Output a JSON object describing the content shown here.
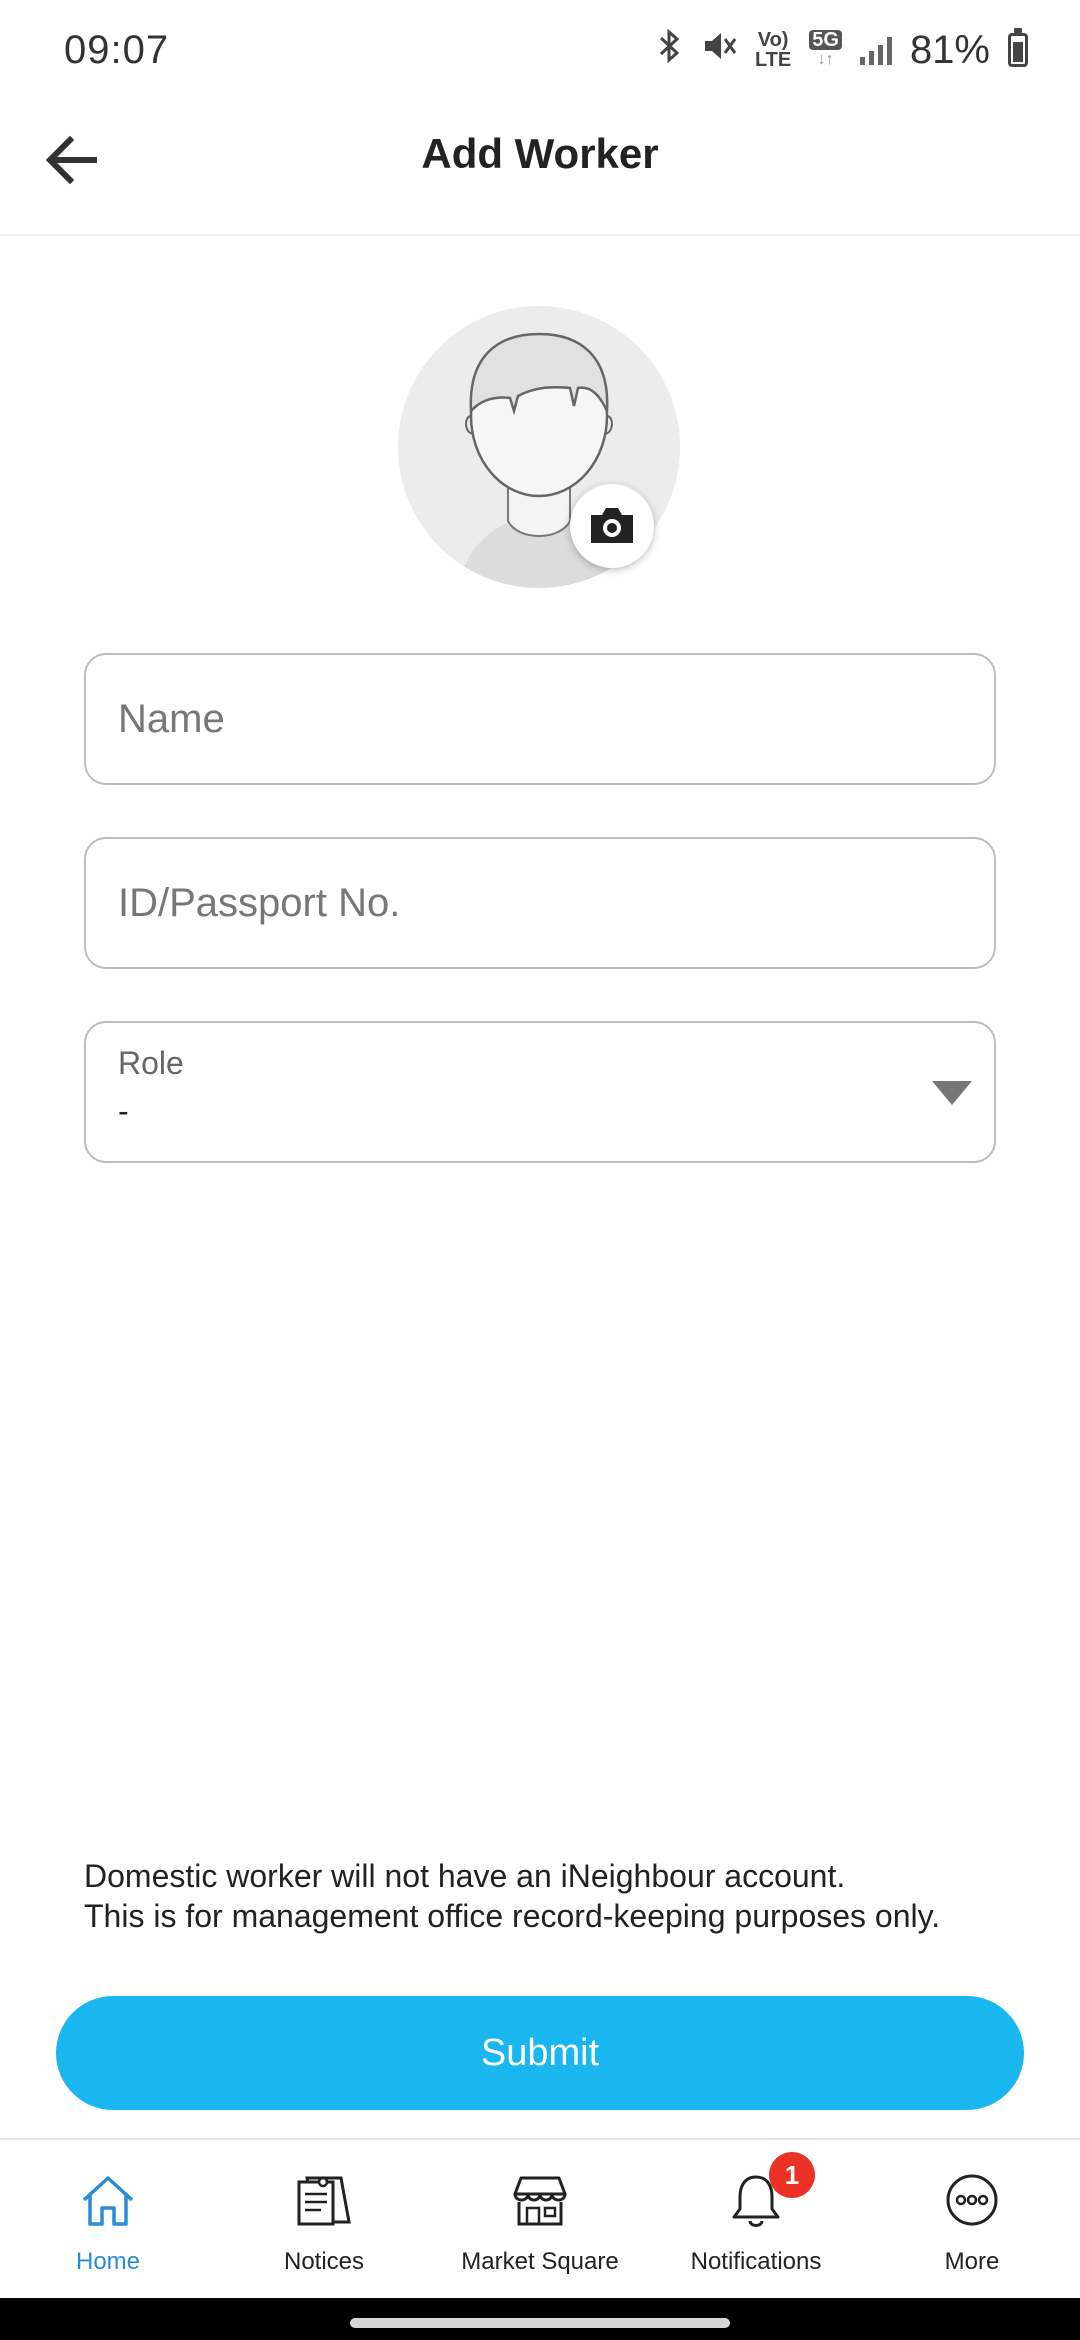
{
  "status_bar": {
    "time": "09:07",
    "lte_label_top": "Vo)",
    "lte_label_bottom": "LTE",
    "network_label": "5G",
    "battery_percent": "81%"
  },
  "header": {
    "title": "Add Worker"
  },
  "form": {
    "name_placeholder": "Name",
    "id_placeholder": "ID/Passport No.",
    "role_label": "Role",
    "role_value": "-"
  },
  "info_note": {
    "line1": "Domestic worker will not have an iNeighbour account.",
    "line2": "This is for management office record-keeping purposes only."
  },
  "submit_label": "Submit",
  "bottom_nav": {
    "items": [
      {
        "label": "Home",
        "icon": "home-icon",
        "active": true
      },
      {
        "label": "Notices",
        "icon": "notices-icon"
      },
      {
        "label": "Market Square",
        "icon": "store-icon"
      },
      {
        "label": "Notifications",
        "icon": "bell-icon",
        "badge": "1"
      },
      {
        "label": "More",
        "icon": "more-icon"
      }
    ]
  },
  "colors": {
    "accent": "#1ab6ef",
    "nav_active": "#2a8bd6",
    "badge": "#ea3324"
  }
}
